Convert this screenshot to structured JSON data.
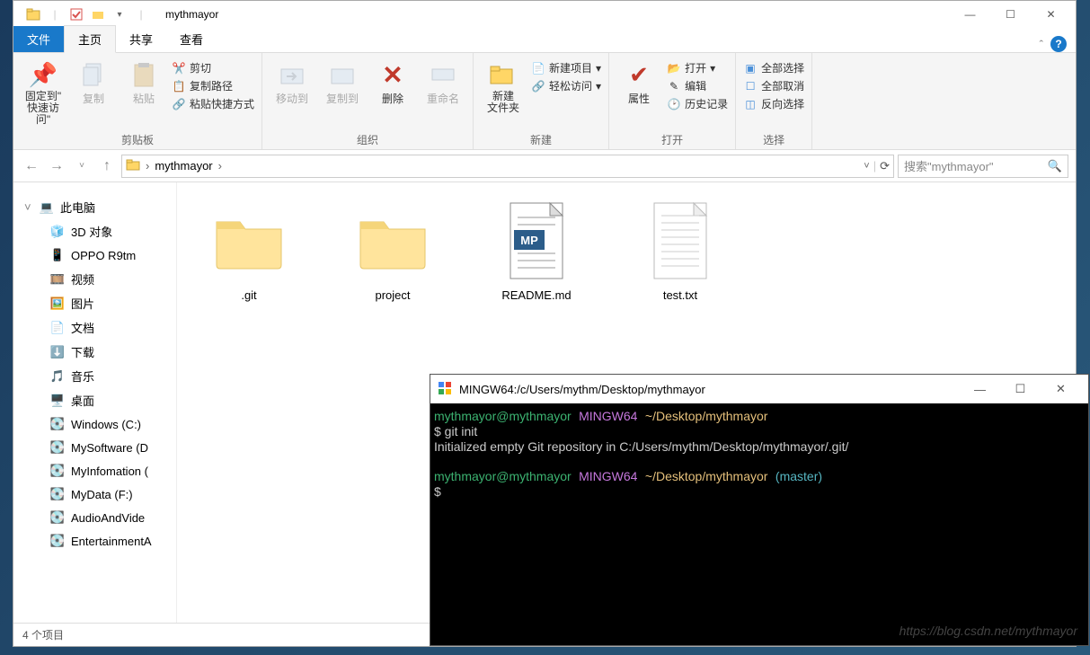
{
  "window": {
    "title": "mythmayor",
    "min": "—",
    "max": "☐",
    "close": "✕"
  },
  "tabs": {
    "file": "文件",
    "home": "主页",
    "share": "共享",
    "view": "查看"
  },
  "ribbon": {
    "clipboard": {
      "label": "剪贴板",
      "pin": "固定到\"\n快速访问\"",
      "copy": "复制",
      "paste": "粘贴",
      "cut": "剪切",
      "copypath": "复制路径",
      "pasteshortcut": "粘贴快捷方式"
    },
    "organize": {
      "label": "组织",
      "moveto": "移动到",
      "copyto": "复制到",
      "delete": "删除",
      "rename": "重命名"
    },
    "new": {
      "label": "新建",
      "newfolder": "新建\n文件夹",
      "newitem": "新建项目",
      "easyaccess": "轻松访问"
    },
    "open": {
      "label": "打开",
      "properties": "属性",
      "open": "打开",
      "edit": "编辑",
      "history": "历史记录"
    },
    "select": {
      "label": "选择",
      "selectall": "全部选择",
      "selectnone": "全部取消",
      "invert": "反向选择"
    }
  },
  "breadcrumb": {
    "current": "mythmayor",
    "chevron": "›"
  },
  "search": {
    "placeholder": "搜索\"mythmayor\""
  },
  "sidebar": {
    "items": [
      {
        "label": "此电脑",
        "icon": "pc"
      },
      {
        "label": "3D 对象",
        "icon": "3d"
      },
      {
        "label": "OPPO R9tm",
        "icon": "phone"
      },
      {
        "label": "视频",
        "icon": "video"
      },
      {
        "label": "图片",
        "icon": "pics"
      },
      {
        "label": "文档",
        "icon": "docs"
      },
      {
        "label": "下载",
        "icon": "dl"
      },
      {
        "label": "音乐",
        "icon": "music"
      },
      {
        "label": "桌面",
        "icon": "desk"
      },
      {
        "label": "Windows (C:)",
        "icon": "disk"
      },
      {
        "label": "MySoftware (D",
        "icon": "disk"
      },
      {
        "label": "MyInfomation (",
        "icon": "disk"
      },
      {
        "label": "MyData (F:)",
        "icon": "disk"
      },
      {
        "label": "AudioAndVide",
        "icon": "disk"
      },
      {
        "label": "EntertainmentA",
        "icon": "disk"
      }
    ]
  },
  "files": [
    {
      "name": ".git",
      "type": "folder"
    },
    {
      "name": "project",
      "type": "folder"
    },
    {
      "name": "README.md",
      "type": "md"
    },
    {
      "name": "test.txt",
      "type": "txt"
    }
  ],
  "status": "4 个项目",
  "terminal": {
    "title": "MINGW64:/c/Users/mythm/Desktop/mythmayor",
    "user": "mythmayor@mythmayor",
    "env": "MINGW64",
    "path": "~/Desktop/mythmayor",
    "cmd": "$ git init",
    "output": "Initialized empty Git repository in C:/Users/mythm/Desktop/mythmayor/.git/",
    "branch": "(master)",
    "prompt2": "$",
    "watermark": "https://blog.csdn.net/mythmayor"
  }
}
